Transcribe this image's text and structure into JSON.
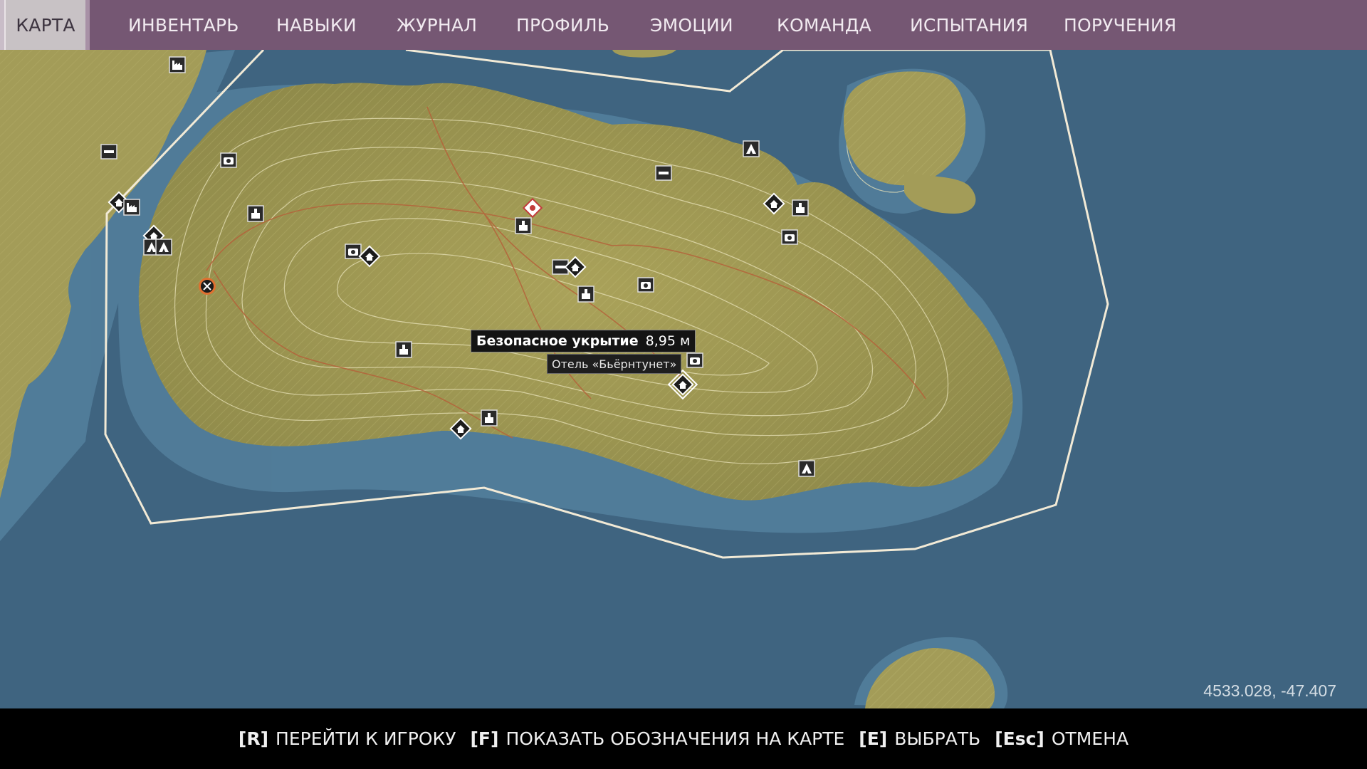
{
  "nav": {
    "tabs": [
      {
        "label": "КАРТА",
        "active": true
      },
      {
        "label": "ИНВЕНТАРЬ"
      },
      {
        "label": "НАВЫКИ"
      },
      {
        "label": "ЖУРНАЛ"
      },
      {
        "label": "ПРОФИЛЬ"
      },
      {
        "label": "ЭМОЦИИ"
      },
      {
        "label": "КОМАНДА"
      },
      {
        "label": "ИСПЫТАНИЯ"
      },
      {
        "label": "ПОРУЧЕНИЯ"
      }
    ]
  },
  "map": {
    "tooltip": {
      "title": "Безопасное укрытие",
      "distance": "8,95 м",
      "location": "Отель «Бьёрнтунет»"
    },
    "coordinates": "4533.028, -47.407",
    "colors": {
      "water": "#3f6480",
      "shallow_water": "#5b86a2",
      "land": "#a19a55",
      "boundary": "#f2ead6",
      "player_marker": "#e07030"
    },
    "icons": [
      "house-icon",
      "camera-icon",
      "factory-icon",
      "tent-icon",
      "bunker-icon",
      "church-icon",
      "objective-icon",
      "player-marker-icon"
    ]
  },
  "bottom_bar": {
    "hints": [
      {
        "key": "[R]",
        "label": "ПЕРЕЙТИ К ИГРОКУ"
      },
      {
        "key": "[F]",
        "label": "ПОКАЗАТЬ ОБОЗНАЧЕНИЯ НА КАРТЕ"
      },
      {
        "key": "[E]",
        "label": "ВЫБРАТЬ"
      },
      {
        "key": "[Esc]",
        "label": "ОТМЕНА"
      }
    ]
  }
}
